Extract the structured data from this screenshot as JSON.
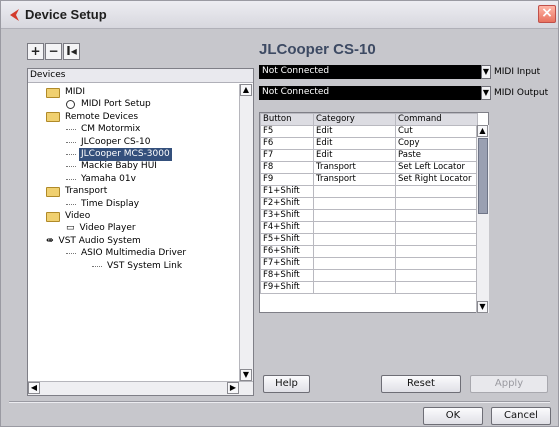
{
  "window": {
    "title": "Device Setup",
    "close_glyph": "×"
  },
  "toolbar": {
    "add_label": "+",
    "remove_label": "−",
    "reset_label": "I◂"
  },
  "devices": {
    "header": "Devices",
    "tree": [
      {
        "label": "MIDI",
        "type": "folder",
        "level": 1
      },
      {
        "label": "MIDI Port Setup",
        "type": "midi",
        "level": 2
      },
      {
        "label": "Remote Devices",
        "type": "folder",
        "level": 1
      },
      {
        "label": "CM Motormix",
        "type": "item",
        "level": 2
      },
      {
        "label": "JLCooper CS-10",
        "type": "item",
        "level": 2
      },
      {
        "label": "JLCooper MCS-3000",
        "type": "item",
        "level": 2,
        "selected": true
      },
      {
        "label": "Mackie Baby HUI",
        "type": "item",
        "level": 2
      },
      {
        "label": "Yamaha 01v",
        "type": "item",
        "level": 2
      },
      {
        "label": "Transport",
        "type": "folder",
        "level": 1
      },
      {
        "label": "Time Display",
        "type": "item",
        "level": 2
      },
      {
        "label": "Video",
        "type": "folder",
        "level": 1
      },
      {
        "label": "Video Player",
        "type": "video",
        "level": 2
      },
      {
        "label": "VST Audio System",
        "type": "vst",
        "level": 1
      },
      {
        "label": "ASIO Multimedia Driver",
        "type": "item",
        "level": 2
      },
      {
        "label": "VST System Link",
        "type": "item",
        "level": 3
      }
    ]
  },
  "device": {
    "title": "JLCooper CS-10",
    "midi_input": {
      "value": "Not Connected",
      "label": "MIDI Input"
    },
    "midi_output": {
      "value": "Not Connected",
      "label": "MIDI Output"
    },
    "table": {
      "headers": [
        "Button",
        "Category",
        "Command"
      ],
      "rows": [
        [
          "F5",
          "Edit",
          "Cut"
        ],
        [
          "F6",
          "Edit",
          "Copy"
        ],
        [
          "F7",
          "Edit",
          "Paste"
        ],
        [
          "F8",
          "Transport",
          "Set Left Locator"
        ],
        [
          "F9",
          "Transport",
          "Set Right Locator"
        ],
        [
          "F1+Shift",
          "",
          ""
        ],
        [
          "F2+Shift",
          "",
          ""
        ],
        [
          "F3+Shift",
          "",
          ""
        ],
        [
          "F4+Shift",
          "",
          ""
        ],
        [
          "F5+Shift",
          "",
          ""
        ],
        [
          "F6+Shift",
          "",
          ""
        ],
        [
          "F7+Shift",
          "",
          ""
        ],
        [
          "F8+Shift",
          "",
          ""
        ],
        [
          "F9+Shift",
          "",
          ""
        ]
      ]
    }
  },
  "buttons": {
    "help": "Help",
    "reset": "Reset",
    "apply": "Apply",
    "ok": "OK",
    "cancel": "Cancel"
  },
  "colors": {
    "selection": "#34507c",
    "title_accent": "#3d4a63",
    "close_red": "#e8725f"
  }
}
